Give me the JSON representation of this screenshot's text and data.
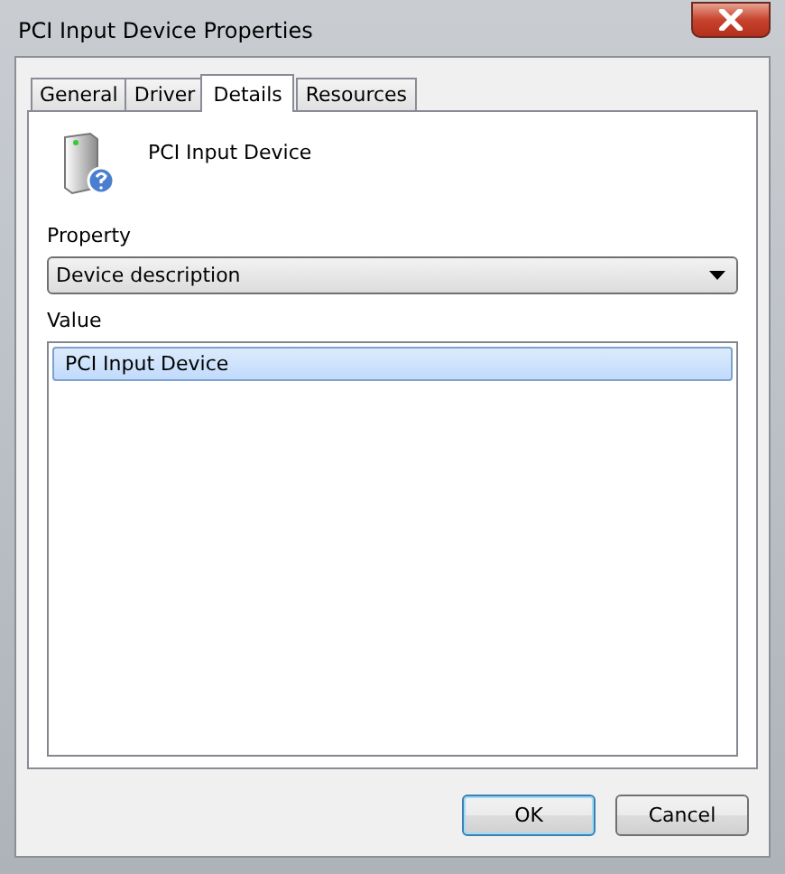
{
  "window": {
    "title": "PCI Input Device Properties"
  },
  "tabs": [
    {
      "label": "General",
      "selected": false
    },
    {
      "label": "Driver",
      "selected": false
    },
    {
      "label": "Details",
      "selected": true
    },
    {
      "label": "Resources",
      "selected": false
    }
  ],
  "device": {
    "name": "PCI Input Device"
  },
  "property": {
    "label": "Property",
    "value": "Device description"
  },
  "value": {
    "label": "Value",
    "items": [
      {
        "text": "PCI Input Device",
        "selected": true
      }
    ]
  },
  "buttons": [
    {
      "label": "OK",
      "default": true
    },
    {
      "label": "Cancel",
      "default": false
    }
  ]
}
